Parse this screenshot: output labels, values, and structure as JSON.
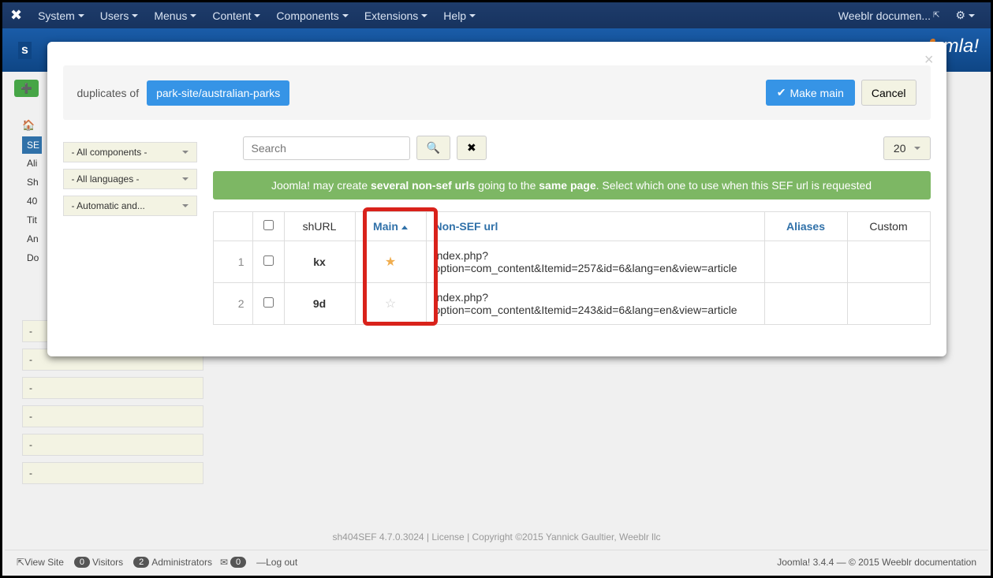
{
  "navbar": {
    "items": [
      "System",
      "Users",
      "Menus",
      "Content",
      "Components",
      "Extensions",
      "Help"
    ],
    "right_link": "Weeblr documen..."
  },
  "modal": {
    "prefix": "duplicates of",
    "url": "park-site/australian-parks",
    "make_main": "Make main",
    "cancel": "Cancel",
    "search_placeholder": "Search",
    "limit": "20",
    "banner_parts": {
      "p1": "Joomla! may create ",
      "b1": "several non-sef urls",
      "p2": " going to the ",
      "b2": "same page",
      "p3": ". Select which one to use when this SEF url is requested"
    },
    "columns": {
      "shurl": "shURL",
      "main": "Main",
      "nonsef": "Non-SEF url",
      "aliases": "Aliases",
      "custom": "Custom"
    },
    "rows": [
      {
        "num": "1",
        "shurl": "kx",
        "main": true,
        "url": "index.php?option=com_content&Itemid=257&id=6&lang=en&view=article"
      },
      {
        "num": "2",
        "shurl": "9d",
        "main": false,
        "url": "index.php?option=com_content&Itemid=243&id=6&lang=en&view=article"
      }
    ]
  },
  "filters": {
    "components": "- All components -",
    "languages": "- All languages -",
    "automatic": "- Automatic and..."
  },
  "sidebar_items": [
    "SE",
    "Ali",
    "Sh",
    "40",
    "Tit",
    "An",
    "Do"
  ],
  "footer": "sh404SEF 4.7.0.3024 | License | Copyright ©2015 Yannick Gaultier, Weeblr llc",
  "status": {
    "view_site": "View Site",
    "visitors": "Visitors",
    "visitors_count": "0",
    "admins": "Administrators",
    "admins_count": "2",
    "msg_count": "0",
    "logout": "Log out",
    "right": "Joomla! 3.4.4 — © 2015 Weeblr documentation"
  }
}
